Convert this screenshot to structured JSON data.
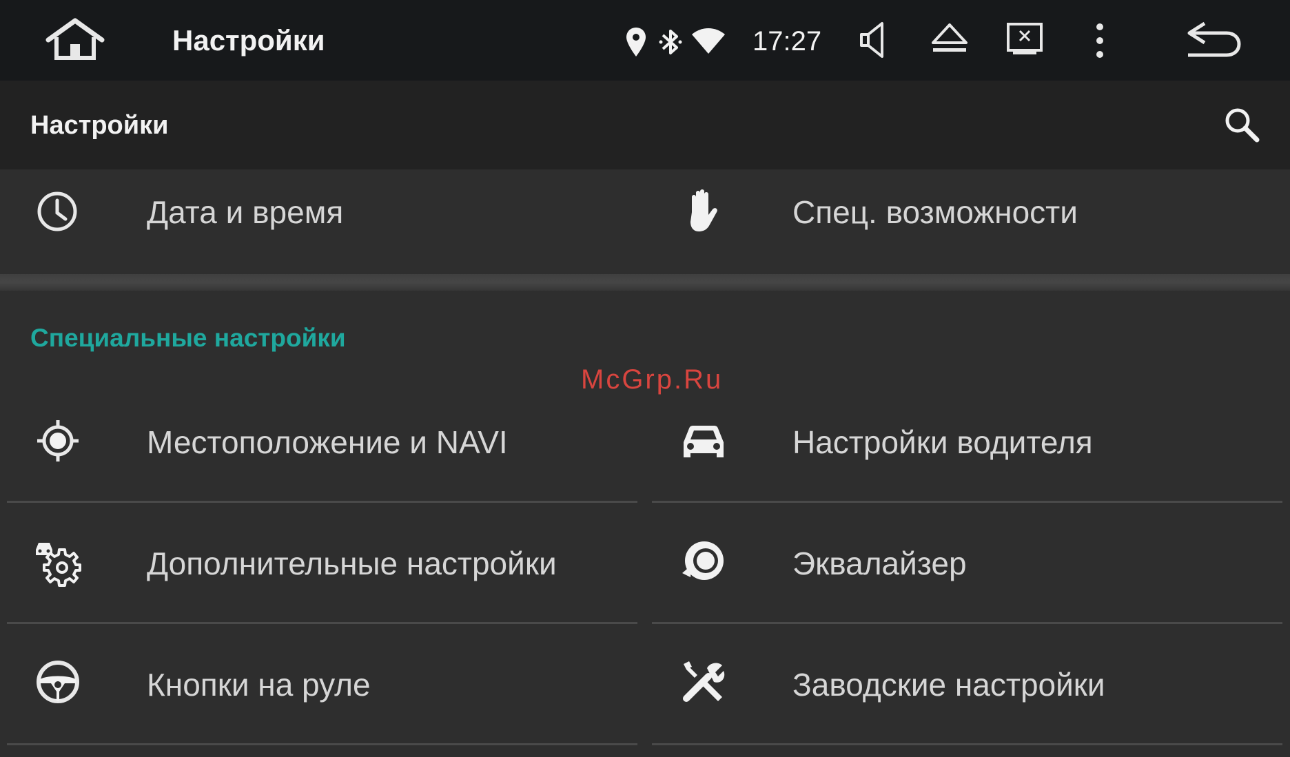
{
  "status_bar": {
    "title": "Настройки",
    "time": "17:27",
    "icons": [
      "home-icon",
      "location-icon",
      "bluetooth-icon",
      "wifi-icon",
      "volume-icon",
      "eject-icon",
      "screen-off-icon",
      "more-vert-icon",
      "back-icon"
    ]
  },
  "header": {
    "title": "Настройки",
    "search_icon": "search-icon"
  },
  "top_items": [
    {
      "label": "Дата и время",
      "icon": "clock-icon"
    },
    {
      "label": "Спец. возможности",
      "icon": "hand-icon"
    }
  ],
  "section": {
    "title": "Специальные настройки",
    "accent_color": "#1fa89e"
  },
  "watermark": "McGrp.Ru",
  "items": [
    {
      "label": "Местоположение и NAVI",
      "icon": "gps-target-icon"
    },
    {
      "label": "Настройки водителя",
      "icon": "car-icon"
    },
    {
      "label": "Дополнительные настройки",
      "icon": "car-gear-icon"
    },
    {
      "label": "Эквалайзер",
      "icon": "speaker-icon"
    },
    {
      "label": "Кнопки на руле",
      "icon": "steering-wheel-icon"
    },
    {
      "label": "Заводские настройки",
      "icon": "tools-icon"
    }
  ]
}
